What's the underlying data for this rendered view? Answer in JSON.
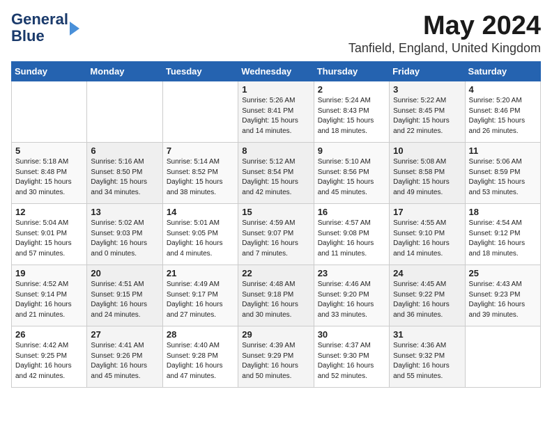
{
  "logo": {
    "line1": "General",
    "line2": "Blue"
  },
  "title": "May 2024",
  "subtitle": "Tanfield, England, United Kingdom",
  "headers": [
    "Sunday",
    "Monday",
    "Tuesday",
    "Wednesday",
    "Thursday",
    "Friday",
    "Saturday"
  ],
  "weeks": [
    [
      {
        "day": "",
        "sunrise": "",
        "sunset": "",
        "daylight": ""
      },
      {
        "day": "",
        "sunrise": "",
        "sunset": "",
        "daylight": ""
      },
      {
        "day": "",
        "sunrise": "",
        "sunset": "",
        "daylight": ""
      },
      {
        "day": "1",
        "sunrise": "Sunrise: 5:26 AM",
        "sunset": "Sunset: 8:41 PM",
        "daylight": "Daylight: 15 hours and 14 minutes."
      },
      {
        "day": "2",
        "sunrise": "Sunrise: 5:24 AM",
        "sunset": "Sunset: 8:43 PM",
        "daylight": "Daylight: 15 hours and 18 minutes."
      },
      {
        "day": "3",
        "sunrise": "Sunrise: 5:22 AM",
        "sunset": "Sunset: 8:45 PM",
        "daylight": "Daylight: 15 hours and 22 minutes."
      },
      {
        "day": "4",
        "sunrise": "Sunrise: 5:20 AM",
        "sunset": "Sunset: 8:46 PM",
        "daylight": "Daylight: 15 hours and 26 minutes."
      }
    ],
    [
      {
        "day": "5",
        "sunrise": "Sunrise: 5:18 AM",
        "sunset": "Sunset: 8:48 PM",
        "daylight": "Daylight: 15 hours and 30 minutes."
      },
      {
        "day": "6",
        "sunrise": "Sunrise: 5:16 AM",
        "sunset": "Sunset: 8:50 PM",
        "daylight": "Daylight: 15 hours and 34 minutes."
      },
      {
        "day": "7",
        "sunrise": "Sunrise: 5:14 AM",
        "sunset": "Sunset: 8:52 PM",
        "daylight": "Daylight: 15 hours and 38 minutes."
      },
      {
        "day": "8",
        "sunrise": "Sunrise: 5:12 AM",
        "sunset": "Sunset: 8:54 PM",
        "daylight": "Daylight: 15 hours and 42 minutes."
      },
      {
        "day": "9",
        "sunrise": "Sunrise: 5:10 AM",
        "sunset": "Sunset: 8:56 PM",
        "daylight": "Daylight: 15 hours and 45 minutes."
      },
      {
        "day": "10",
        "sunrise": "Sunrise: 5:08 AM",
        "sunset": "Sunset: 8:58 PM",
        "daylight": "Daylight: 15 hours and 49 minutes."
      },
      {
        "day": "11",
        "sunrise": "Sunrise: 5:06 AM",
        "sunset": "Sunset: 8:59 PM",
        "daylight": "Daylight: 15 hours and 53 minutes."
      }
    ],
    [
      {
        "day": "12",
        "sunrise": "Sunrise: 5:04 AM",
        "sunset": "Sunset: 9:01 PM",
        "daylight": "Daylight: 15 hours and 57 minutes."
      },
      {
        "day": "13",
        "sunrise": "Sunrise: 5:02 AM",
        "sunset": "Sunset: 9:03 PM",
        "daylight": "Daylight: 16 hours and 0 minutes."
      },
      {
        "day": "14",
        "sunrise": "Sunrise: 5:01 AM",
        "sunset": "Sunset: 9:05 PM",
        "daylight": "Daylight: 16 hours and 4 minutes."
      },
      {
        "day": "15",
        "sunrise": "Sunrise: 4:59 AM",
        "sunset": "Sunset: 9:07 PM",
        "daylight": "Daylight: 16 hours and 7 minutes."
      },
      {
        "day": "16",
        "sunrise": "Sunrise: 4:57 AM",
        "sunset": "Sunset: 9:08 PM",
        "daylight": "Daylight: 16 hours and 11 minutes."
      },
      {
        "day": "17",
        "sunrise": "Sunrise: 4:55 AM",
        "sunset": "Sunset: 9:10 PM",
        "daylight": "Daylight: 16 hours and 14 minutes."
      },
      {
        "day": "18",
        "sunrise": "Sunrise: 4:54 AM",
        "sunset": "Sunset: 9:12 PM",
        "daylight": "Daylight: 16 hours and 18 minutes."
      }
    ],
    [
      {
        "day": "19",
        "sunrise": "Sunrise: 4:52 AM",
        "sunset": "Sunset: 9:14 PM",
        "daylight": "Daylight: 16 hours and 21 minutes."
      },
      {
        "day": "20",
        "sunrise": "Sunrise: 4:51 AM",
        "sunset": "Sunset: 9:15 PM",
        "daylight": "Daylight: 16 hours and 24 minutes."
      },
      {
        "day": "21",
        "sunrise": "Sunrise: 4:49 AM",
        "sunset": "Sunset: 9:17 PM",
        "daylight": "Daylight: 16 hours and 27 minutes."
      },
      {
        "day": "22",
        "sunrise": "Sunrise: 4:48 AM",
        "sunset": "Sunset: 9:18 PM",
        "daylight": "Daylight: 16 hours and 30 minutes."
      },
      {
        "day": "23",
        "sunrise": "Sunrise: 4:46 AM",
        "sunset": "Sunset: 9:20 PM",
        "daylight": "Daylight: 16 hours and 33 minutes."
      },
      {
        "day": "24",
        "sunrise": "Sunrise: 4:45 AM",
        "sunset": "Sunset: 9:22 PM",
        "daylight": "Daylight: 16 hours and 36 minutes."
      },
      {
        "day": "25",
        "sunrise": "Sunrise: 4:43 AM",
        "sunset": "Sunset: 9:23 PM",
        "daylight": "Daylight: 16 hours and 39 minutes."
      }
    ],
    [
      {
        "day": "26",
        "sunrise": "Sunrise: 4:42 AM",
        "sunset": "Sunset: 9:25 PM",
        "daylight": "Daylight: 16 hours and 42 minutes."
      },
      {
        "day": "27",
        "sunrise": "Sunrise: 4:41 AM",
        "sunset": "Sunset: 9:26 PM",
        "daylight": "Daylight: 16 hours and 45 minutes."
      },
      {
        "day": "28",
        "sunrise": "Sunrise: 4:40 AM",
        "sunset": "Sunset: 9:28 PM",
        "daylight": "Daylight: 16 hours and 47 minutes."
      },
      {
        "day": "29",
        "sunrise": "Sunrise: 4:39 AM",
        "sunset": "Sunset: 9:29 PM",
        "daylight": "Daylight: 16 hours and 50 minutes."
      },
      {
        "day": "30",
        "sunrise": "Sunrise: 4:37 AM",
        "sunset": "Sunset: 9:30 PM",
        "daylight": "Daylight: 16 hours and 52 minutes."
      },
      {
        "day": "31",
        "sunrise": "Sunrise: 4:36 AM",
        "sunset": "Sunset: 9:32 PM",
        "daylight": "Daylight: 16 hours and 55 minutes."
      },
      {
        "day": "",
        "sunrise": "",
        "sunset": "",
        "daylight": ""
      }
    ]
  ]
}
